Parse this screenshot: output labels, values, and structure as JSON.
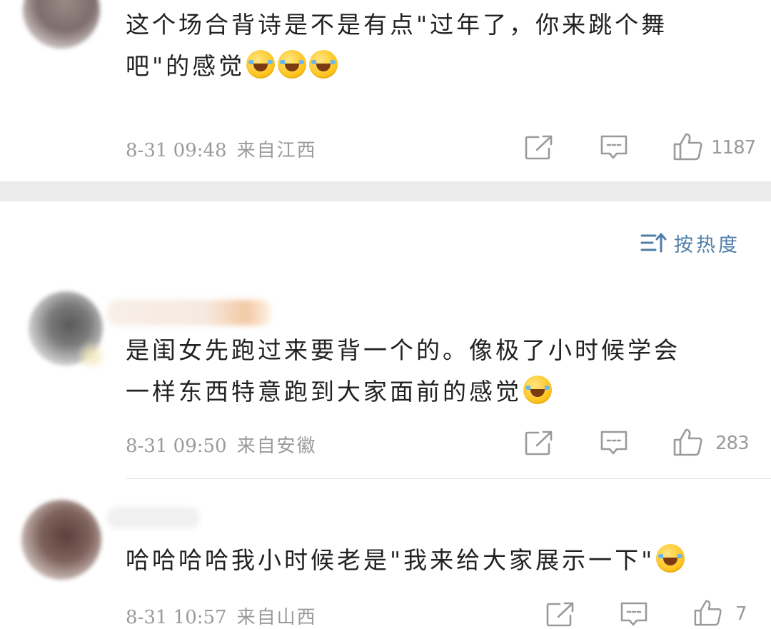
{
  "comments": [
    {
      "text_lines": [
        "这个场合背诗是不是有点\"过年了，你来跳个舞",
        "吧\"的感觉"
      ],
      "emoji_count": 3,
      "emoji_name": "laughing-crying-emoji",
      "time": "8-31 09:48",
      "location": "来自江西",
      "likes": "1187"
    },
    {
      "text_lines": [
        "是闺女先跑过来要背一个的。像极了小时候学会",
        "一样东西特意跑到大家面前的感觉"
      ],
      "emoji_count": 1,
      "emoji_name": "grinning-sweat-emoji",
      "time": "8-31 09:50",
      "location": "来自安徽",
      "likes": "283"
    },
    {
      "text_lines": [
        "哈哈哈哈我小时候老是\"我来给大家展示一下\""
      ],
      "emoji_count": 1,
      "emoji_name": "laughing-crying-emoji",
      "time": "8-31 10:57",
      "location": "来自山西",
      "likes": "7"
    }
  ],
  "sort": {
    "label": "按热度",
    "icon": "sort-icon"
  },
  "icons": {
    "share": "share-icon",
    "reply": "comment-icon",
    "like": "thumbs-up-icon"
  },
  "colors": {
    "text": "#222222",
    "meta": "#9a9a9a",
    "accent": "#4f7ea8",
    "divider_band": "#ececec"
  }
}
